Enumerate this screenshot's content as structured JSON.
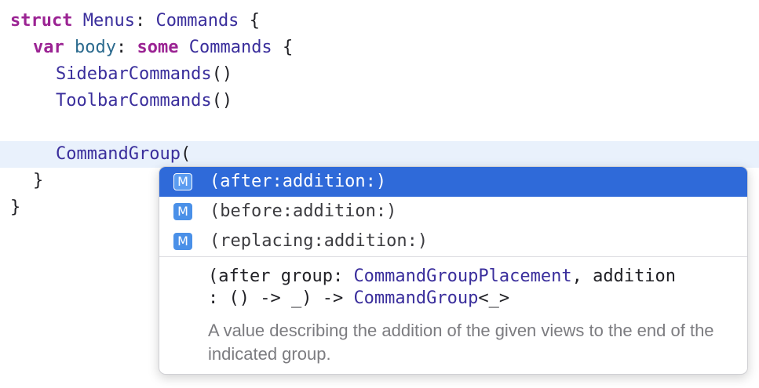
{
  "code": {
    "line1": {
      "kw": "struct",
      "name": "Menus",
      "colon": ":",
      "type": "Commands",
      "brace": "{"
    },
    "line2": {
      "kw_var": "var",
      "name": "body",
      "colon": ":",
      "kw_some": "some",
      "type": "Commands",
      "brace": "{"
    },
    "line3": {
      "call": "SidebarCommands",
      "parens": "()"
    },
    "line4": {
      "call": "ToolbarCommands",
      "parens": "()"
    },
    "line6": {
      "call": "CommandGroup",
      "paren": "("
    },
    "line7": {
      "brace": "}"
    },
    "line8": {
      "brace": "}"
    }
  },
  "completion": {
    "items": [
      {
        "badge": "M",
        "label": "(after:addition:)"
      },
      {
        "badge": "M",
        "label": "(before:addition:)"
      },
      {
        "badge": "M",
        "label": "(replacing:addition:)"
      }
    ],
    "signature": {
      "p1": "(after group: ",
      "t1": "CommandGroupPlacement",
      "p2": ", addition",
      "p3": ": () -> _) -> ",
      "t2": "CommandGroup",
      "p4": "<_>"
    },
    "description": "A value describing the addition of the given views to the end of the indicated group."
  },
  "colors": {
    "keyword": "#9b2393",
    "type": "#3a2e9c",
    "identifier": "#2b6a8e",
    "selection": "#2f6ad9",
    "current_line": "#e9f1fc"
  }
}
